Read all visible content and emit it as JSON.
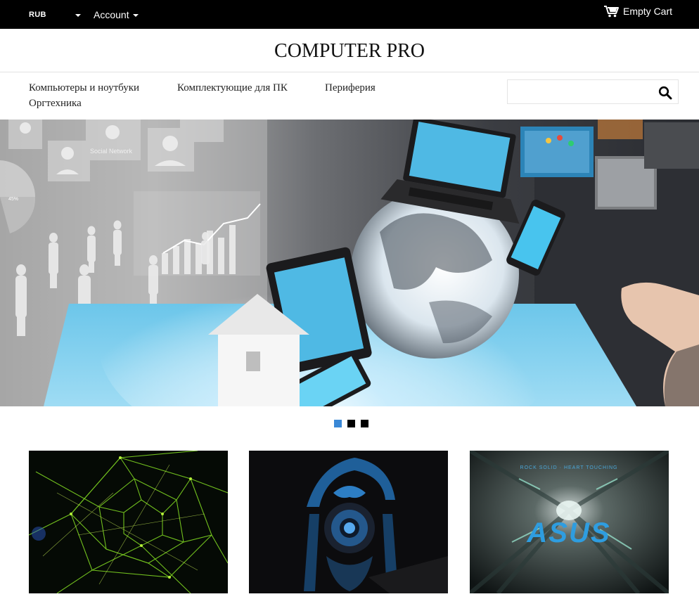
{
  "topbar": {
    "currency": "RUB",
    "account_label": "Account",
    "cart_label": "Empty Cart",
    "cart_icon": "cart-icon"
  },
  "logo": {
    "text": "COMPUTER PRO"
  },
  "nav": {
    "items": [
      {
        "label": "Компьютеры и ноутбуки"
      },
      {
        "label": "Комплектующие для ПК"
      },
      {
        "label": "Периферия"
      },
      {
        "label": "Оргтехника"
      }
    ]
  },
  "search": {
    "placeholder": "",
    "value": "",
    "icon": "search-icon"
  },
  "hero": {
    "alt": "",
    "labels": {
      "social": "Social Network",
      "percent": "45%"
    }
  },
  "slider": {
    "slides": 3,
    "active": 1
  },
  "thumbnails": [
    {
      "name": "green-network-banner"
    },
    {
      "name": "blue-dragon-logo-banner"
    },
    {
      "name": "asus-tunnel-banner",
      "tagline": "ROCK SOLID · HEART TOUCHING",
      "brand": "ASUS"
    }
  ],
  "colors": {
    "topbar": "#000000",
    "accent": "#3a88d6",
    "text": "#222222"
  }
}
